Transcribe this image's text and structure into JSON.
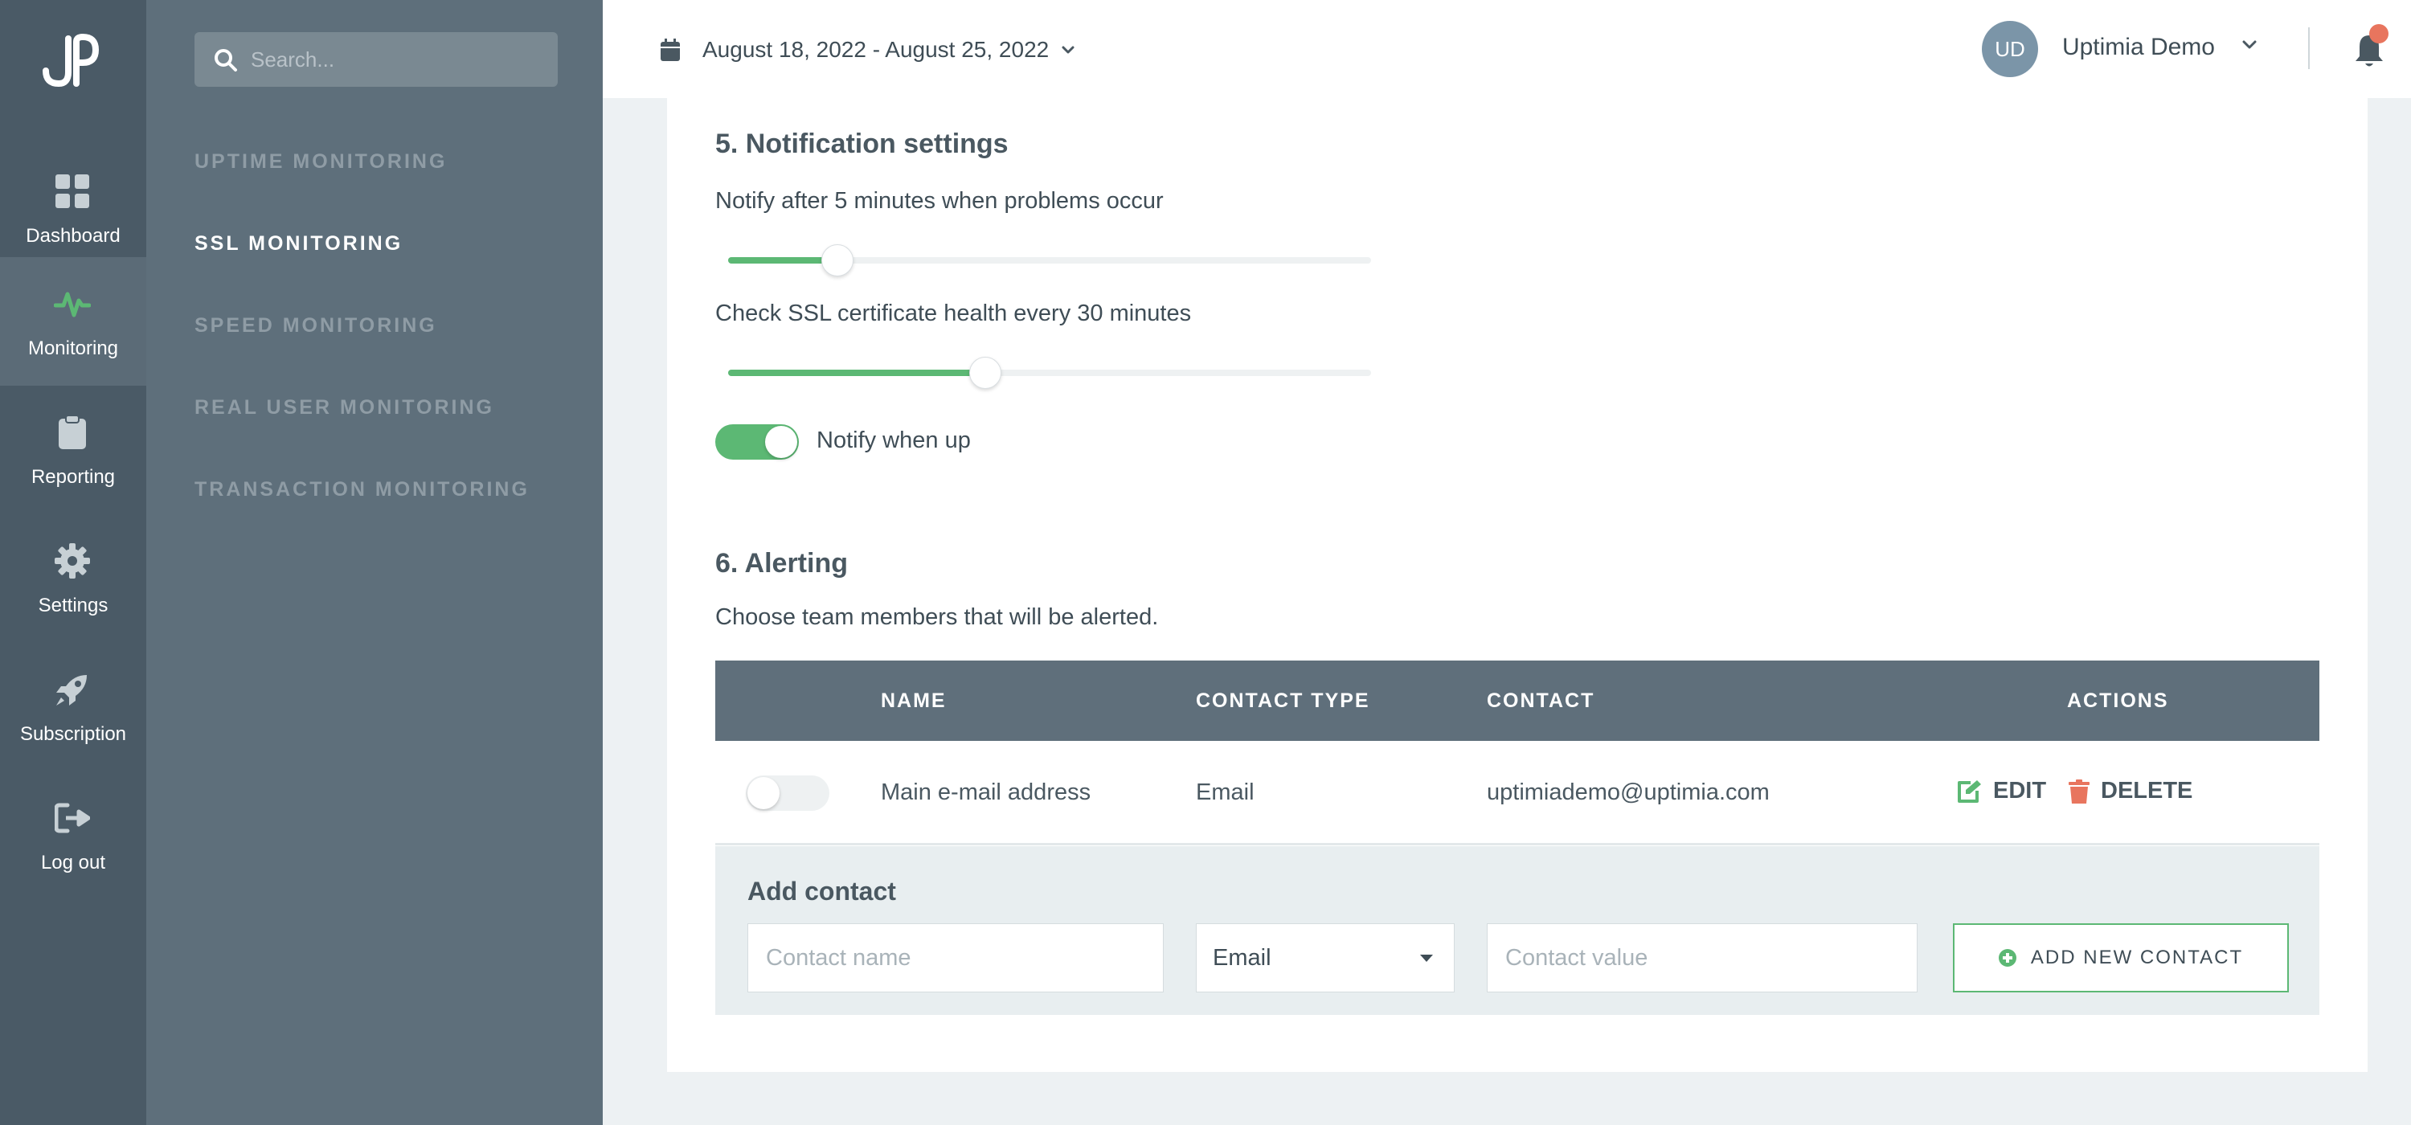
{
  "colors": {
    "accent": "#5cb874",
    "danger": "#e8755e",
    "rail_bg": "#4a5a66",
    "subnav_bg": "#5e6f7b",
    "table_header_bg": "#5f6f7b"
  },
  "rail": {
    "logo_text": "JP",
    "items": [
      {
        "label": "Dashboard",
        "icon": "grid-icon",
        "active": false
      },
      {
        "label": "Monitoring",
        "icon": "pulse-icon",
        "active": true
      },
      {
        "label": "Reporting",
        "icon": "clipboard-icon",
        "active": false
      },
      {
        "label": "Settings",
        "icon": "gear-icon",
        "active": false
      },
      {
        "label": "Subscription",
        "icon": "rocket-icon",
        "active": false
      },
      {
        "label": "Log out",
        "icon": "logout-icon",
        "active": false
      }
    ]
  },
  "subnav": {
    "search_placeholder": "Search...",
    "items": [
      {
        "label": "UPTIME MONITORING",
        "active": false
      },
      {
        "label": "SSL MONITORING",
        "active": true
      },
      {
        "label": "SPEED MONITORING",
        "active": false
      },
      {
        "label": "REAL USER MONITORING",
        "active": false
      },
      {
        "label": "TRANSACTION MONITORING",
        "active": false
      }
    ]
  },
  "topbar": {
    "date_range": "August 18, 2022 - August 25, 2022",
    "avatar_initials": "UD",
    "user_name": "Uptimia Demo",
    "has_notification": true
  },
  "notification": {
    "title": "5. Notification settings",
    "notify_after_text": "Notify after 5 minutes when problems occur",
    "notify_after_level": 0.17,
    "check_interval_text": "Check SSL certificate health every 30 minutes",
    "check_interval_level": 0.4,
    "notify_when_up_label": "Notify when up",
    "notify_when_up_on": true
  },
  "alerting": {
    "title": "6. Alerting",
    "description": "Choose team members that will be alerted.",
    "columns": {
      "name": "NAME",
      "contact_type": "CONTACT TYPE",
      "contact": "CONTACT",
      "actions": "ACTIONS"
    },
    "rows": [
      {
        "enabled": false,
        "name": "Main e-mail address",
        "contact_type": "Email",
        "contact": "uptimiademo@uptimia.com",
        "edit_label": "EDIT",
        "delete_label": "DELETE"
      }
    ],
    "add": {
      "title": "Add contact",
      "name_placeholder": "Contact name",
      "type_value": "Email",
      "value_placeholder": "Contact value",
      "button_label": "ADD NEW CONTACT"
    }
  }
}
